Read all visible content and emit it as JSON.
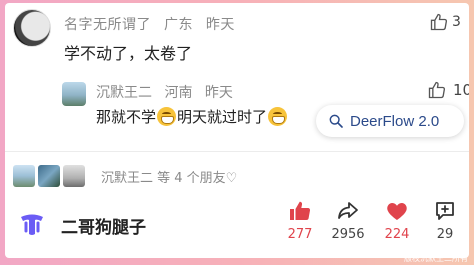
{
  "comment": {
    "author": "名字无所谓了",
    "location": "广东",
    "time": "昨天",
    "text": "学不动了，太卷了",
    "likes": "3"
  },
  "reply": {
    "author": "沉默王二",
    "location": "河南",
    "time": "昨天",
    "text_part1": "那就不学",
    "text_part2": "明天就过时了",
    "likes": "10"
  },
  "tooltip": {
    "label": "DeerFlow 2.0"
  },
  "friends": {
    "text": "沉默王二 等 4 个朋友♡"
  },
  "app": {
    "name": "二哥狗腿子"
  },
  "actions": {
    "like_count": "277",
    "share_count": "2956",
    "heart_count": "224",
    "comment_count": "29"
  },
  "watermark": "版权沉默王二所有",
  "colors": {
    "accent": "#e0444c",
    "brand": "#6b5cf5"
  }
}
